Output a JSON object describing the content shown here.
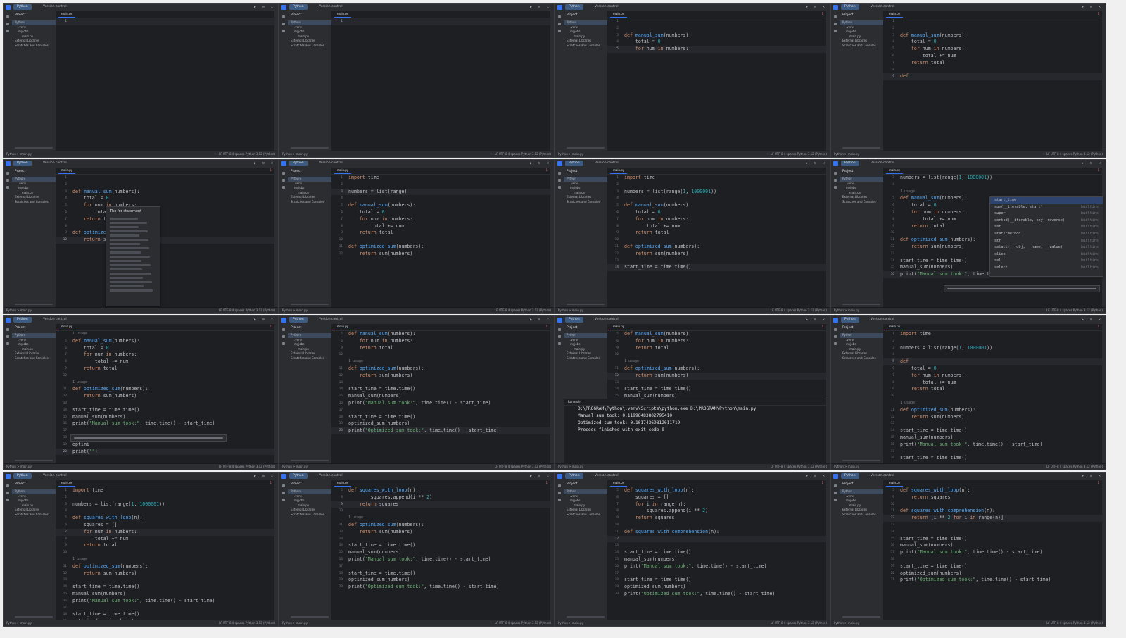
{
  "title_bar": {
    "project": "Python",
    "vcs": "Version control"
  },
  "project_panel": {
    "header": "Project",
    "tree": [
      {
        "label": "Python",
        "level": 0,
        "selected": true
      },
      {
        "label": ".venv",
        "level": 1
      },
      {
        "label": "myjobs",
        "level": 1
      },
      {
        "label": "main.py",
        "level": 2
      },
      {
        "label": "External Libraries",
        "level": 0
      },
      {
        "label": "Scratches and Consoles",
        "level": 0
      }
    ]
  },
  "file_tab": "main.py",
  "status_bar": {
    "breadcrumb": "Python > main.py",
    "right": "LF  UTF-8  4 spaces  Python 3.12 (Python)"
  },
  "frames": [
    {
      "warn": "",
      "lines": [
        {
          "n": "1",
          "t": ""
        }
      ],
      "cur": 0
    },
    {
      "warn": "",
      "lines": [
        {
          "n": "1",
          "t": ""
        }
      ],
      "cur": 0
    },
    {
      "warn": "1",
      "lines": [
        {
          "n": "1",
          "t": ""
        },
        {
          "n": "2",
          "t": ""
        },
        {
          "n": "3",
          "t": "def manual_sum(numbers):"
        },
        {
          "n": "4",
          "t": "    total = 0"
        },
        {
          "n": "5",
          "t": "    for num in numbers:"
        }
      ],
      "cur": 4
    },
    {
      "warn": "1",
      "lines": [
        {
          "n": "1",
          "t": ""
        },
        {
          "n": "2",
          "t": ""
        },
        {
          "n": "3",
          "t": "def manual_sum(numbers):"
        },
        {
          "n": "4",
          "t": "    total = 0"
        },
        {
          "n": "5",
          "t": "    for num in numbers:"
        },
        {
          "n": "6",
          "t": "        total += num"
        },
        {
          "n": "7",
          "t": "    return total"
        },
        {
          "n": "8",
          "t": ""
        },
        {
          "n": "9",
          "t": "def "
        }
      ],
      "cur": 8
    },
    {
      "warn": "1",
      "lines": [
        {
          "n": "1",
          "t": ""
        },
        {
          "n": "2",
          "t": ""
        },
        {
          "n": "3",
          "t": "def manual_sum(numbers):"
        },
        {
          "n": "4",
          "t": "    total = 0"
        },
        {
          "n": "5",
          "t": "    for num in numbers:"
        },
        {
          "n": "6",
          "t": "        total"
        },
        {
          "n": "7",
          "t": "    return t"
        },
        {
          "n": "8",
          "t": ""
        },
        {
          "n": "9",
          "t": "def optimized"
        },
        {
          "n": "10",
          "t": "    return s"
        }
      ],
      "cur": 9,
      "doc": "The for statement"
    },
    {
      "warn": "1",
      "lines": [
        {
          "n": "1",
          "t": "import time"
        },
        {
          "n": "2",
          "t": ""
        },
        {
          "n": "3",
          "t": "numbers = list(range)"
        },
        {
          "n": "4",
          "t": ""
        },
        {
          "n": "5",
          "t": "def manual_sum(numbers):"
        },
        {
          "n": "6",
          "t": "    total = 0"
        },
        {
          "n": "7",
          "t": "    for num in numbers:"
        },
        {
          "n": "8",
          "t": "        total += num"
        },
        {
          "n": "9",
          "t": "    return total"
        },
        {
          "n": "10",
          "t": ""
        },
        {
          "n": "11",
          "t": "def optimized_sum(numbers):"
        },
        {
          "n": "12",
          "t": "    return sum(numbers)"
        }
      ],
      "cur": 2
    },
    {
      "warn": "",
      "lines": [
        {
          "n": "1",
          "t": "import time"
        },
        {
          "n": "2",
          "t": ""
        },
        {
          "n": "3",
          "t": "numbers = list(range(1, 1000001))"
        },
        {
          "n": "4",
          "t": ""
        },
        {
          "n": "5",
          "t": "def manual_sum(numbers):"
        },
        {
          "n": "6",
          "t": "    total = 0"
        },
        {
          "n": "7",
          "t": "    for num in numbers:"
        },
        {
          "n": "8",
          "t": "        total += num"
        },
        {
          "n": "9",
          "t": "    return total"
        },
        {
          "n": "10",
          "t": ""
        },
        {
          "n": "11",
          "t": "def optimized_sum(numbers):"
        },
        {
          "n": "12",
          "t": "    return sum(numbers)"
        },
        {
          "n": "13",
          "t": ""
        },
        {
          "n": "14",
          "t": "start_time = time.time()"
        }
      ],
      "cur": 13
    },
    {
      "warn": "1",
      "lines": [
        {
          "n": "3",
          "t": "numbers = list(range(1, 1000001))"
        },
        {
          "n": "4",
          "t": ""
        },
        {
          "n": "",
          "t": "1 usage",
          "c": true
        },
        {
          "n": "5",
          "t": "def manual_sum(numbers):"
        },
        {
          "n": "6",
          "t": "    total = 0"
        },
        {
          "n": "7",
          "t": "    for num in numbers:"
        },
        {
          "n": "8",
          "t": "        total += num"
        },
        {
          "n": "9",
          "t": "    return total"
        },
        {
          "n": "10",
          "t": ""
        },
        {
          "n": "11",
          "t": "def optimized_sum(numbers):"
        },
        {
          "n": "12",
          "t": "    return sum(numbers)"
        },
        {
          "n": "13",
          "t": ""
        },
        {
          "n": "14",
          "t": "start_time = time.time()"
        },
        {
          "n": "15",
          "t": "manual_sum(numbers)"
        },
        {
          "n": "16",
          "t": "print(\"Manual sum took:\", time.time() - s)"
        }
      ],
      "cur": 14,
      "completion": [
        "start_time",
        "sum(__iterable, start)",
        "super",
        "sorted(__iterable, key, reverse)",
        "set",
        "staticmethod",
        "str",
        "setattr(__obj, __name, __value)",
        "slice",
        "sel",
        "select"
      ],
      "completion_src": "builtins"
    },
    {
      "warn": "1",
      "lines": [
        {
          "n": "",
          "t": "1 usage",
          "c": true
        },
        {
          "n": "5",
          "t": "def manual_sum(numbers):"
        },
        {
          "n": "6",
          "t": "    total = 0"
        },
        {
          "n": "7",
          "t": "    for num in numbers:"
        },
        {
          "n": "8",
          "t": "        total += num"
        },
        {
          "n": "9",
          "t": "    return total"
        },
        {
          "n": "10",
          "t": ""
        },
        {
          "n": "",
          "t": "1 usage",
          "c": true
        },
        {
          "n": "11",
          "t": "def optimized_sum(numbers):"
        },
        {
          "n": "12",
          "t": "    return sum(numbers)"
        },
        {
          "n": "13",
          "t": ""
        },
        {
          "n": "14",
          "t": "start_time = time.time()"
        },
        {
          "n": "15",
          "t": "manual_sum(numbers)"
        },
        {
          "n": "16",
          "t": "print(\"Manual sum took:\", time.time() - start_time)"
        },
        {
          "n": "17",
          "t": ""
        },
        {
          "n": "18",
          "t": "start"
        },
        {
          "n": "19",
          "t": "optimi"
        },
        {
          "n": "20",
          "t": "print(\"\")"
        }
      ],
      "cur": 17
    },
    {
      "warn": "1",
      "lines": [
        {
          "n": "5",
          "t": "def manual_sum(numbers):"
        },
        {
          "n": "6",
          "t": "    for num in numbers:"
        },
        {
          "n": "9",
          "t": "    return total"
        },
        {
          "n": "10",
          "t": ""
        },
        {
          "n": "",
          "t": "1 usage",
          "c": true
        },
        {
          "n": "11",
          "t": "def optimized_sum(numbers):"
        },
        {
          "n": "12",
          "t": "    return sum(numbers)"
        },
        {
          "n": "13",
          "t": ""
        },
        {
          "n": "14",
          "t": "start_time = time.time()"
        },
        {
          "n": "15",
          "t": "manual_sum(numbers)"
        },
        {
          "n": "16",
          "t": "print(\"Manual sum took:\", time.time() - start_time)"
        },
        {
          "n": "17",
          "t": ""
        },
        {
          "n": "18",
          "t": "start_time = time.time()"
        },
        {
          "n": "19",
          "t": "optimized_sum(numbers)"
        },
        {
          "n": "20",
          "t": "print(\"Optimized sum took:\", time.time() - start_time)"
        }
      ],
      "cur": 14
    },
    {
      "warn": "1",
      "lines": [
        {
          "n": "5",
          "t": "def manual_sum(numbers):"
        },
        {
          "n": "6",
          "t": "    for num in numbers:"
        },
        {
          "n": "9",
          "t": "    return total"
        },
        {
          "n": "10",
          "t": ""
        },
        {
          "n": "",
          "t": "1 usage",
          "c": true
        },
        {
          "n": "11",
          "t": "def optimized_sum(numbers):"
        },
        {
          "n": "12",
          "t": "    return sum(numbers)"
        },
        {
          "n": "13",
          "t": ""
        },
        {
          "n": "14",
          "t": "start_time = time.time()"
        },
        {
          "n": "15",
          "t": "manual_sum(numbers)"
        }
      ],
      "cur": 6,
      "run": {
        "header": "Run  main",
        "lines": [
          "D:\\PROGRAM\\Python\\.venv\\Scripts\\python.exe D:\\PROGRAM\\Python\\main.py",
          "Manual sum took: 0.11996483802795410",
          "Optimized sum took: 0.10174369812011719",
          "",
          "Process finished with exit code 0"
        ]
      }
    },
    {
      "warn": "1",
      "lines": [
        {
          "n": "1",
          "t": "import time"
        },
        {
          "n": "2",
          "t": ""
        },
        {
          "n": "3",
          "t": "numbers = list(range(1, 1000001))"
        },
        {
          "n": "4",
          "t": ""
        },
        {
          "n": "5",
          "t": "def "
        },
        {
          "n": "6",
          "t": "    total = 0"
        },
        {
          "n": "7",
          "t": "    for num in numbers:"
        },
        {
          "n": "8",
          "t": "        total += num"
        },
        {
          "n": "9",
          "t": "    return total"
        },
        {
          "n": "10",
          "t": ""
        },
        {
          "n": "",
          "t": "1 usage",
          "c": true
        },
        {
          "n": "11",
          "t": "def optimized_sum(numbers):"
        },
        {
          "n": "12",
          "t": "    return sum(numbers)"
        },
        {
          "n": "13",
          "t": ""
        },
        {
          "n": "14",
          "t": "start_time = time.time()"
        },
        {
          "n": "15",
          "t": "manual_sum(numbers)"
        },
        {
          "n": "16",
          "t": "print(\"Manual sum took:\", time.time() - start_time)"
        },
        {
          "n": "17",
          "t": ""
        },
        {
          "n": "18",
          "t": "start_time = time.time()"
        }
      ],
      "cur": 4
    },
    {
      "warn": "1",
      "lines": [
        {
          "n": "1",
          "t": "import time"
        },
        {
          "n": "2",
          "t": ""
        },
        {
          "n": "3",
          "t": "numbers = list(range(1, 1000001))"
        },
        {
          "n": "4",
          "t": ""
        },
        {
          "n": "5",
          "t": "def squares_with_loop(n):"
        },
        {
          "n": "6",
          "t": "    squares = []"
        },
        {
          "n": "7",
          "t": "    for num in numbers:"
        },
        {
          "n": "8",
          "t": "        total += num"
        },
        {
          "n": "9",
          "t": "    return total"
        },
        {
          "n": "10",
          "t": ""
        },
        {
          "n": "",
          "t": "1 usage",
          "c": true
        },
        {
          "n": "11",
          "t": "def optimized_sum(numbers):"
        },
        {
          "n": "12",
          "t": "    return sum(numbers)"
        },
        {
          "n": "13",
          "t": ""
        },
        {
          "n": "14",
          "t": "start_time = time.time()"
        },
        {
          "n": "15",
          "t": "manual_sum(numbers)"
        },
        {
          "n": "16",
          "t": "print(\"Manual sum took:\", time.time() - start_time)"
        },
        {
          "n": "17",
          "t": ""
        },
        {
          "n": "18",
          "t": "start_time = time.time()"
        },
        {
          "n": "19",
          "t": "optimized_sum(numbers)"
        }
      ],
      "cur": 6
    },
    {
      "warn": "1",
      "lines": [
        {
          "n": "5",
          "t": "def squares_with_loop(n):"
        },
        {
          "n": "8",
          "t": "        squares.append(i ** 2)"
        },
        {
          "n": "9",
          "t": "    return squares"
        },
        {
          "n": "10",
          "t": ""
        },
        {
          "n": "",
          "t": "1 usage",
          "c": true
        },
        {
          "n": "11",
          "t": "def optimized_sum(numbers):"
        },
        {
          "n": "12",
          "t": "    return sum(numbers)"
        },
        {
          "n": "13",
          "t": ""
        },
        {
          "n": "14",
          "t": "start_time = time.time()"
        },
        {
          "n": "15",
          "t": "manual_sum(numbers)"
        },
        {
          "n": "16",
          "t": "print(\"Manual sum took:\", time.time() - start_time)"
        },
        {
          "n": "17",
          "t": ""
        },
        {
          "n": "18",
          "t": "start_time = time.time()"
        },
        {
          "n": "19",
          "t": "optimized_sum(numbers)"
        },
        {
          "n": "20",
          "t": "print(\"Optimized sum took:\", time.time() - start_time)"
        }
      ],
      "cur": 2
    },
    {
      "warn": "1",
      "lines": [
        {
          "n": "5",
          "t": "def squares_with_loop(n):"
        },
        {
          "n": "6",
          "t": "    squares = []"
        },
        {
          "n": "7",
          "t": "    for i in range(n):"
        },
        {
          "n": "8",
          "t": "        squares.append(i ** 2)"
        },
        {
          "n": "9",
          "t": "    return squares"
        },
        {
          "n": "10",
          "t": ""
        },
        {
          "n": "11",
          "t": "def squares_with_comprehension(n):"
        },
        {
          "n": "12",
          "t": "    "
        },
        {
          "n": "13",
          "t": ""
        },
        {
          "n": "14",
          "t": "start_time = time.time()"
        },
        {
          "n": "15",
          "t": "manual_sum(numbers)"
        },
        {
          "n": "16",
          "t": "print(\"Manual sum took:\", time.time() - start_time)"
        },
        {
          "n": "17",
          "t": ""
        },
        {
          "n": "18",
          "t": "start_time = time.time()"
        },
        {
          "n": "19",
          "t": "optimized_sum(numbers)"
        },
        {
          "n": "20",
          "t": "print(\"Optimized sum took:\", time.time() - start_time)"
        }
      ],
      "cur": 7
    },
    {
      "warn": "1",
      "lines": [
        {
          "n": "5",
          "t": "def squares_with_loop(n):"
        },
        {
          "n": "9",
          "t": "    return squares"
        },
        {
          "n": "10",
          "t": ""
        },
        {
          "n": "11",
          "t": "def squares_with_comprehension(n):"
        },
        {
          "n": "12",
          "t": "    return [i ** 2 for i in range(n)]"
        },
        {
          "n": "13",
          "t": ""
        },
        {
          "n": "14",
          "t": ""
        },
        {
          "n": "15",
          "t": "start_time = time.time()"
        },
        {
          "n": "16",
          "t": "manual_sum(numbers)"
        },
        {
          "n": "17",
          "t": "print(\"Manual sum took:\", time.time() - start_time)"
        },
        {
          "n": "18",
          "t": ""
        },
        {
          "n": "19",
          "t": "start_time = time.time()"
        },
        {
          "n": "20",
          "t": "optimized_sum(numbers)"
        },
        {
          "n": "21",
          "t": "print(\"Optimized sum took:\", time.time() - start_time)"
        }
      ],
      "cur": 4
    }
  ]
}
